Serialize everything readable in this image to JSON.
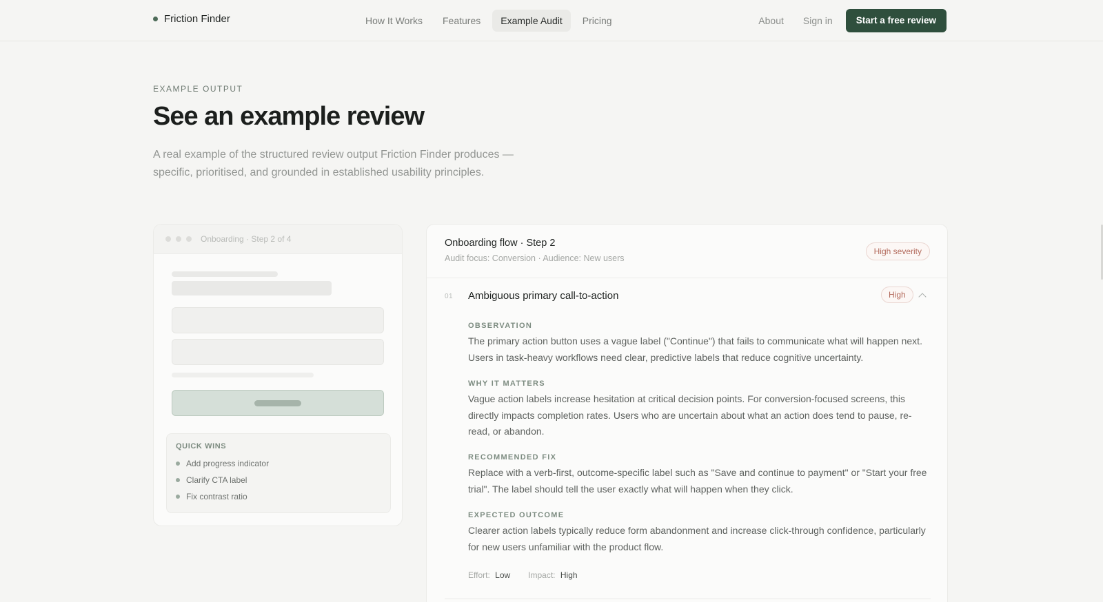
{
  "brand": {
    "name": "Friction Finder",
    "accent": "#2f4f3d"
  },
  "nav": {
    "links": [
      "How It Works",
      "Features",
      "Example Audit",
      "Pricing"
    ],
    "active": "Example Audit",
    "about": "About",
    "signin": "Sign in",
    "cta": "Start a free review"
  },
  "hero": {
    "eyebrow": "EXAMPLE OUTPUT",
    "title": "See an example review",
    "subtitle": "A real example of the structured review output Friction Finder produces — specific, prioritised, and grounded in established usability principles."
  },
  "mock": {
    "window_title": "Onboarding · Step 2 of 4",
    "quick_wins_title": "QUICK WINS",
    "quick_wins": [
      "Add progress indicator",
      "Clarify CTA label",
      "Fix contrast ratio"
    ]
  },
  "audit": {
    "title": "Onboarding flow · Step 2",
    "meta": "Audit focus: Conversion · Audience: New users",
    "severity_badge": "High severity",
    "issue": {
      "number": "01",
      "title": "Ambiguous primary call-to-action",
      "badge": "High",
      "sections": [
        {
          "label": "OBSERVATION",
          "text": "The primary action button uses a vague label (\"Continue\") that fails to communicate what will happen next. Users in task-heavy workflows need clear, predictive labels that reduce cognitive uncertainty."
        },
        {
          "label": "WHY IT MATTERS",
          "text": "Vague action labels increase hesitation at critical decision points. For conversion-focused screens, this directly impacts completion rates. Users who are uncertain about what an action does tend to pause, re-read, or abandon."
        },
        {
          "label": "RECOMMENDED FIX",
          "text": "Replace with a verb-first, outcome-specific label such as \"Save and continue to payment\" or \"Start your free trial\". The label should tell the user exactly what will happen when they click."
        },
        {
          "label": "EXPECTED OUTCOME",
          "text": "Clearer action labels typically reduce form abandonment and increase click-through confidence, particularly for new users unfamiliar with the product flow."
        }
      ],
      "effort_label": "Effort:",
      "effort_value": "Low",
      "impact_label": "Impact:",
      "impact_value": "High"
    }
  }
}
